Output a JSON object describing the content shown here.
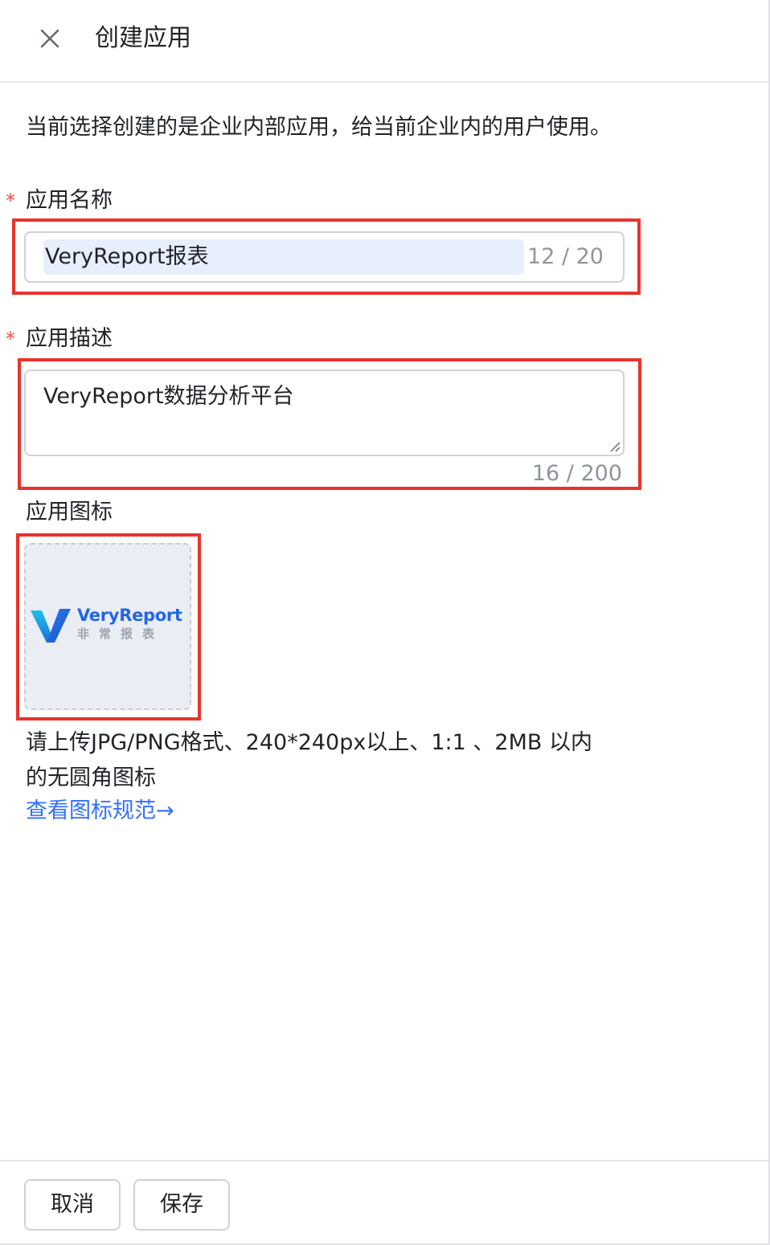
{
  "header": {
    "title": "创建应用",
    "close_icon": "close-icon"
  },
  "intro_text": "当前选择创建的是企业内部应用，给当前企业内的用户使用。",
  "form": {
    "required_mark": "*",
    "name": {
      "label": "应用名称",
      "value": "VeryReport报表",
      "count": "12 / 20"
    },
    "description": {
      "label": "应用描述",
      "value": "VeryReport数据分析平台",
      "count": "16 / 200"
    },
    "icon": {
      "label": "应用图标",
      "logo_text": "VeryReport",
      "logo_subtext": "非常报表",
      "hint_line1": "请上传JPG/PNG格式、240*240px以上、1:1 、2MB 以内",
      "hint_line2": "的无圆角图标",
      "spec_link": "查看图标规范→"
    }
  },
  "footer": {
    "cancel_label": "取消",
    "save_label": "保存"
  },
  "colors": {
    "accent": "#3370ff",
    "required": "#f54a45",
    "highlight_border": "#e8332c",
    "logo_blue": "#2266e8"
  }
}
